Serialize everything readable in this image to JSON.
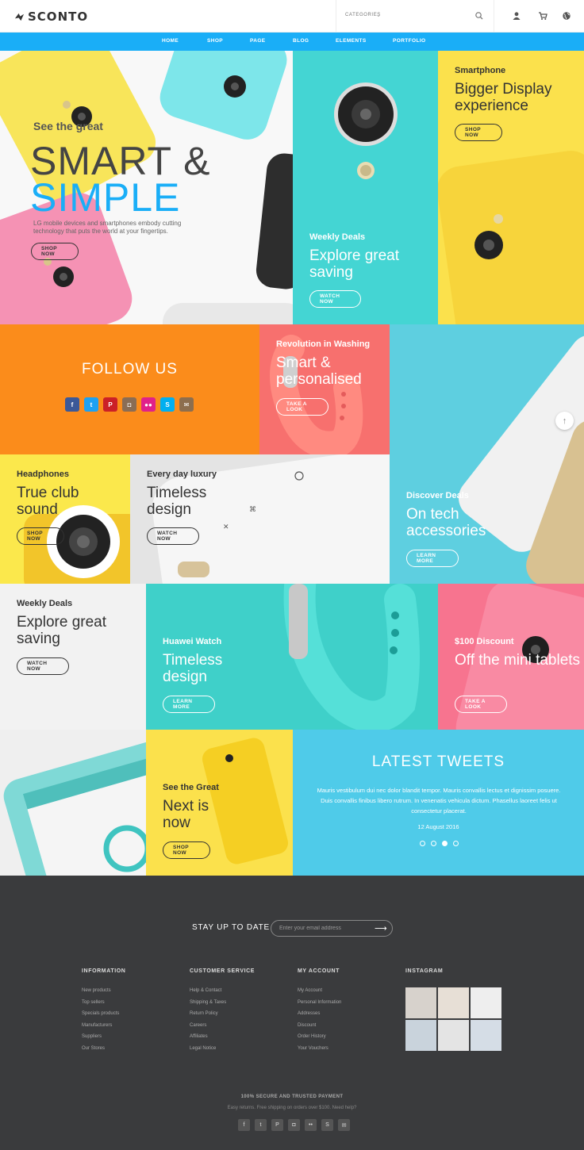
{
  "header": {
    "logo": "SCONTO",
    "categories_label": "CATEGORIES",
    "icons": [
      "search-icon",
      "user-icon",
      "cart-icon",
      "globe-icon"
    ]
  },
  "nav": {
    "items": [
      "HOME",
      "SHOP",
      "PAGE",
      "BLOG",
      "ELEMENTS",
      "PORTFOLIO"
    ]
  },
  "hero": {
    "kicker": "See the great",
    "headline_1": "SMART &",
    "headline_2": "SIMPLE",
    "description": "LG mobile devices and smartphones embody cutting technology that puts the world at your fingertips.",
    "button": "SHOP NOW"
  },
  "tiles": {
    "weekly_top": {
      "label": "Weekly Deals",
      "title": "Explore great saving",
      "button": "WATCH NOW"
    },
    "smartphone": {
      "label": "Smartphone",
      "title": "Bigger Display experience",
      "button": "SHOP NOW"
    },
    "follow": {
      "title": "FOLLOW US",
      "icons": [
        "facebook-icon",
        "twitter-icon",
        "pinterest-icon",
        "instagram-icon",
        "flickr-icon",
        "skype-icon",
        "mail-icon"
      ]
    },
    "washing": {
      "label": "Revolution in Washing",
      "title": "Smart & personalised",
      "button": "TAKE A LOOK"
    },
    "discover": {
      "label": "Discover Deals",
      "title": "On tech accessories",
      "button": "LEARN MORE"
    },
    "headphones": {
      "label": "Headphones",
      "title": "True club sound",
      "button": "SHOP NOW"
    },
    "luxury": {
      "label": "Every day luxury",
      "title": "Timeless design",
      "button": "WATCH NOW"
    },
    "weekly_mid": {
      "label": "Weekly Deals",
      "title": "Explore great saving",
      "button": "WATCH NOW"
    },
    "huawei": {
      "label": "Huawei Watch",
      "title": "Timeless design",
      "button": "LEARN MORE"
    },
    "discount": {
      "label": "$100 Discount",
      "title": "Off the mini tablets",
      "button": "TAKE A LOOK"
    },
    "next": {
      "label": "See the Great",
      "title": "Next is now",
      "button": "SHOP NOW"
    }
  },
  "tweets": {
    "title": "LATEST TWEETS",
    "text": "Mauris vestibulum dui nec dolor blandit tempor. Mauris convallis lectus et dignissim posuere. Duis convallis finibus libero rutrum. In venenatis vehicula dictum. Phasellus laoreet felis ut consectetur placerat.",
    "date": "12 August 2016",
    "active_slide": 3,
    "slide_count": 4
  },
  "footer": {
    "newsletter_label": "STAY UP TO DATE",
    "newsletter_placeholder": "Enter your email address",
    "columns": [
      {
        "heading": "INFORMATION",
        "items": [
          "New products",
          "Top sellers",
          "Specials products",
          "Manufacturers",
          "Suppliers",
          "Our Stores"
        ]
      },
      {
        "heading": "CUSTOMER SERVICE",
        "items": [
          "Help & Contact",
          "Shipping & Taxes",
          "Return Policy",
          "Careers",
          "Affiliates",
          "Legal Notice"
        ]
      },
      {
        "heading": "MY ACCOUNT",
        "items": [
          "My Account",
          "Personal Information",
          "Addresses",
          "Discount",
          "Order History",
          "Your Vouchers"
        ]
      }
    ],
    "instagram_heading": "INSTAGRAM",
    "secure": "100% SECURE AND TRUSTED PAYMENT",
    "easy": "Easy returns. Free shipping on orders over $100. Need help?"
  },
  "colors": {
    "accent": "#1aaef7",
    "teal": "#44d5d3",
    "yellow": "#fbe14c",
    "orange": "#fb8c1b",
    "coral": "#f7706e",
    "sky": "#5ecfe0",
    "pink": "#f7748f",
    "footer": "#3a3b3d"
  }
}
